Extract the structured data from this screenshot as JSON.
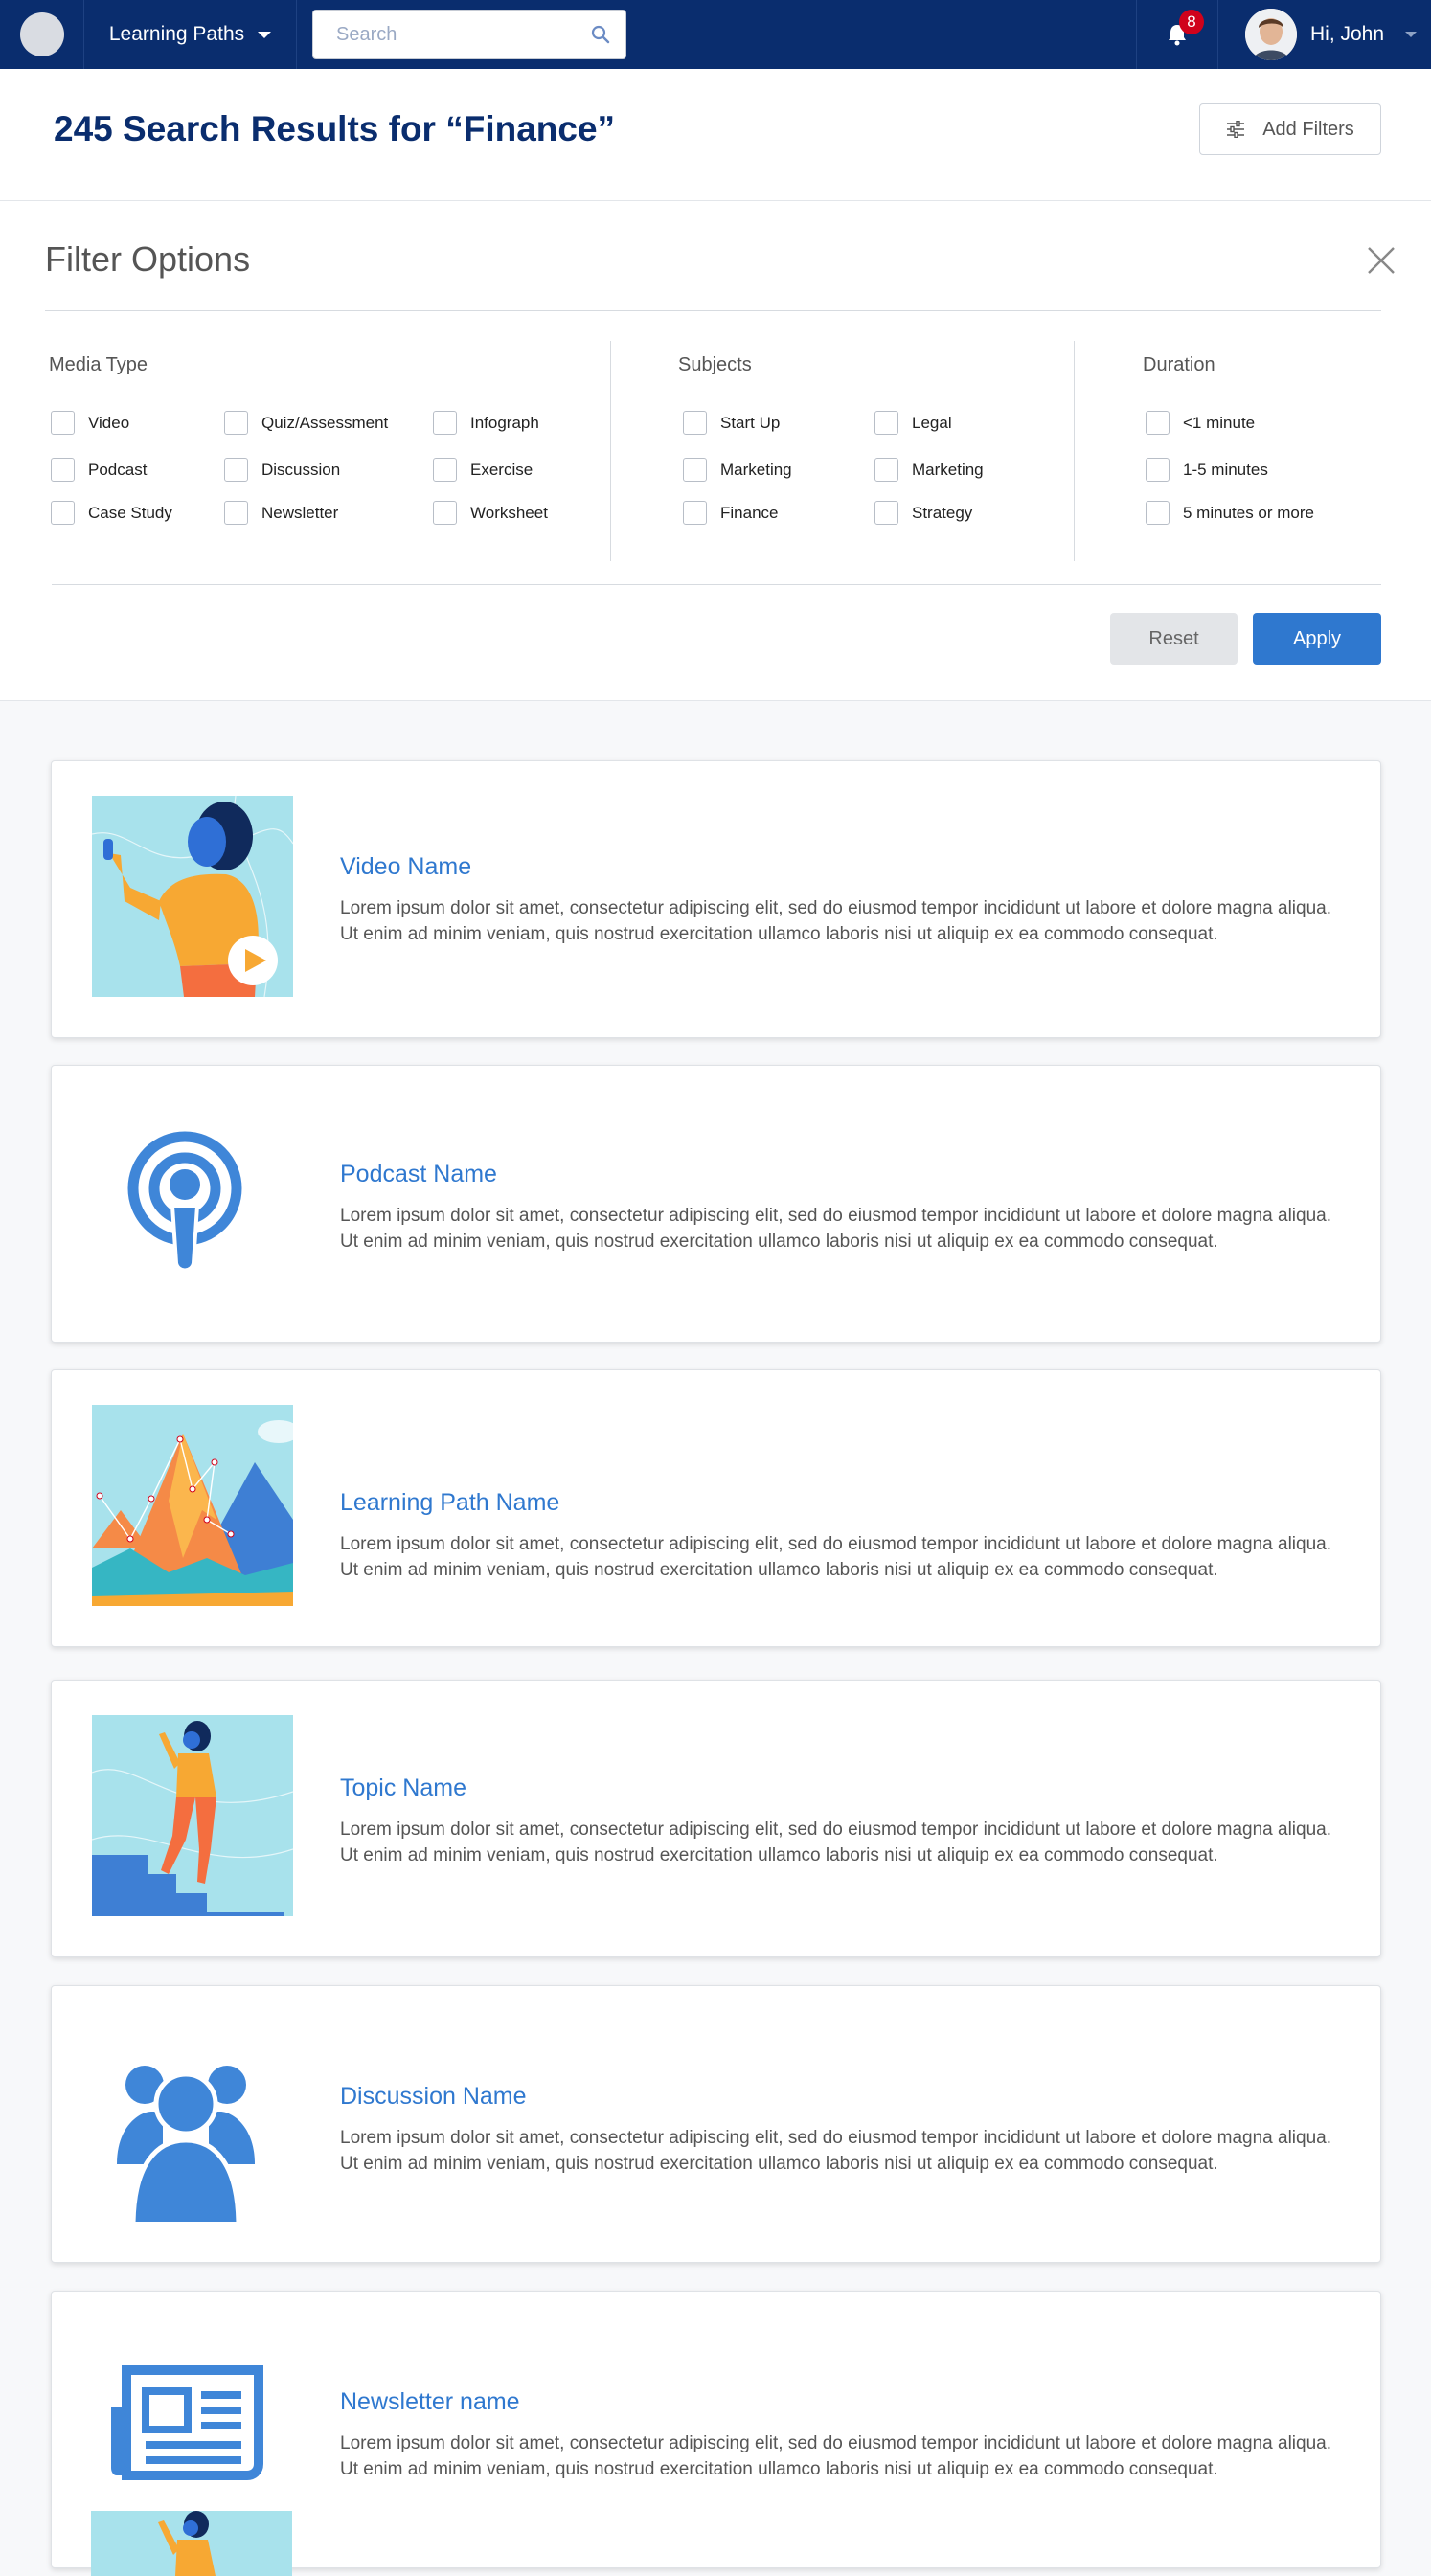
{
  "nav": {
    "learning_paths_label": "Learning Paths",
    "search_placeholder": "Search",
    "notification_count": "8",
    "greeting": "Hi, John"
  },
  "results": {
    "title": "245 Search Results for “Finance”",
    "add_filters_label": "Add Filters"
  },
  "filters": {
    "title": "Filter Options",
    "media_type": {
      "title": "Media Type",
      "options": [
        "Video",
        "Quiz/Assessment",
        "Infograph",
        "Podcast",
        "Discussion",
        "Exercise",
        "Case Study",
        "Newsletter",
        "Worksheet"
      ]
    },
    "subjects": {
      "title": "Subjects",
      "options": [
        "Start Up",
        "Legal",
        "Marketing",
        "Marketing",
        "Finance",
        "Strategy"
      ]
    },
    "duration": {
      "title": "Duration",
      "options": [
        "<1 minute",
        "1-5 minutes",
        "5 minutes or more"
      ]
    },
    "reset_label": "Reset",
    "apply_label": "Apply"
  },
  "cards": [
    {
      "name": "Video Name",
      "icon": "video-thumbnail",
      "description": "Lorem ipsum dolor sit amet, consectetur adipiscing elit, sed do eiusmod tempor incididunt ut labore et dolore magna aliqua. Ut enim ad minim veniam, quis nostrud exercitation ullamco laboris nisi ut aliquip ex ea commodo consequat."
    },
    {
      "name": "Podcast Name",
      "icon": "podcast-icon",
      "description": "Lorem ipsum dolor sit amet, consectetur adipiscing elit, sed do eiusmod tempor incididunt ut labore et dolore magna aliqua. Ut enim ad minim veniam, quis nostrud exercitation ullamco laboris nisi ut aliquip ex ea commodo consequat."
    },
    {
      "name": "Learning Path Name",
      "icon": "mountain-thumbnail",
      "description": "Lorem ipsum dolor sit amet, consectetur adipiscing elit, sed do eiusmod tempor incididunt ut labore et dolore magna aliqua. Ut enim ad minim veniam, quis nostrud exercitation ullamco laboris nisi ut aliquip ex ea commodo consequat."
    },
    {
      "name": "Topic Name",
      "icon": "stairs-thumbnail",
      "description": "Lorem ipsum dolor sit amet, consectetur adipiscing elit, sed do eiusmod tempor incididunt ut labore et dolore magna aliqua. Ut enim ad minim veniam, quis nostrud exercitation ullamco laboris nisi ut aliquip ex ea commodo consequat."
    },
    {
      "name": "Discussion Name",
      "icon": "group-icon",
      "description": "Lorem ipsum dolor sit amet, consectetur adipiscing elit, sed do eiusmod tempor incididunt ut labore et dolore magna aliqua. Ut enim ad minim veniam, quis nostrud exercitation ullamco laboris nisi ut aliquip ex ea commodo consequat."
    },
    {
      "name": "Newsletter name",
      "icon": "newspaper-icon",
      "description": "Lorem ipsum dolor sit amet, consectetur adipiscing elit, sed do eiusmod tempor incididunt ut labore et dolore magna aliqua. Ut enim ad minim veniam, quis nostrud exercitation ullamco laboris nisi ut aliquip ex ea commodo consequat."
    }
  ],
  "colors": {
    "nav_bg": "#0a2d6e",
    "accent": "#2f78cf",
    "badge": "#d0021b"
  }
}
